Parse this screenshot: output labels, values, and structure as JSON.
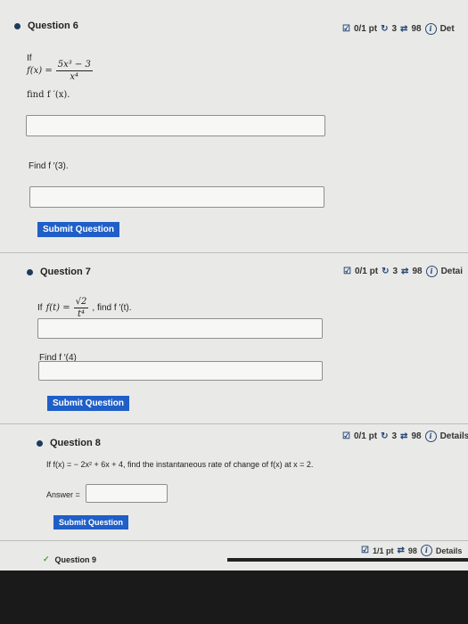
{
  "q6": {
    "title": "Question 6",
    "score": "0/1 pt",
    "retries": "3",
    "attempts": "98",
    "details": "Det",
    "if_label": "If",
    "f_lhs": "f(x) =",
    "frac_num": "5x³ − 3",
    "frac_den": "x⁴",
    "find_label": "find f ′(x).",
    "find2_label": "Find f ′(3).",
    "submit": "Submit Question"
  },
  "q7": {
    "title": "Question 7",
    "score": "0/1 pt",
    "retries": "3",
    "attempts": "98",
    "details": "Detai",
    "if_label": "If",
    "f_lhs": "f(t) =",
    "frac_num": "√2",
    "frac_den": "t⁴",
    "find_suffix": ", find f ′(t).",
    "find2_label": "Find f ′(4)",
    "submit": "Submit Question"
  },
  "q8": {
    "title": "Question 8",
    "score": "0/1 pt",
    "retries": "3",
    "attempts": "98",
    "details": "Details",
    "prompt": "If f(x) = − 2x² + 6x + 4, find the instantaneous rate of change of f(x) at x = 2.",
    "answer_label": "Answer =",
    "submit": "Submit Question"
  },
  "q9": {
    "title": "Question 9",
    "score": "1/1 pt",
    "attempts": "98",
    "details": "Details"
  }
}
